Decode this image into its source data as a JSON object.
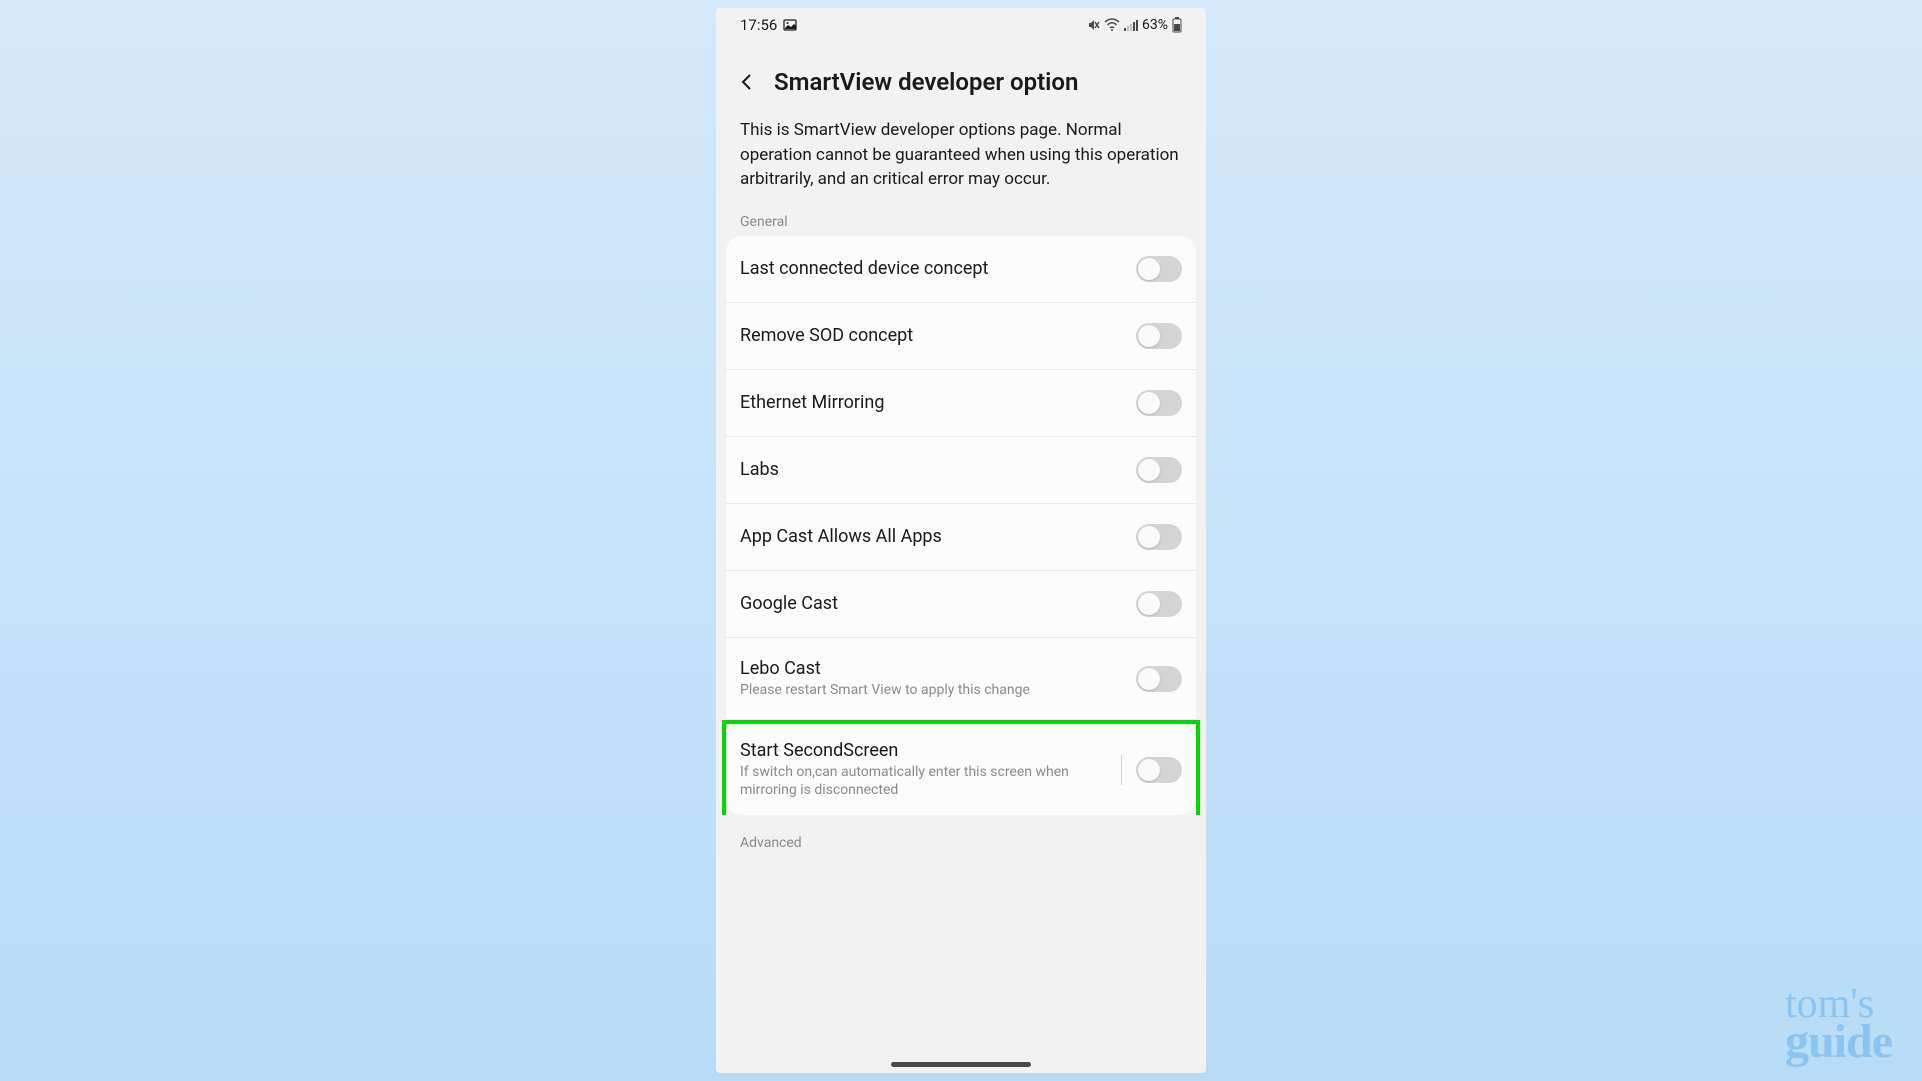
{
  "status_bar": {
    "time": "17:56",
    "battery_percent": "63%"
  },
  "header": {
    "title": "SmartView developer option"
  },
  "description": "This is SmartView developer options page. Normal operation cannot be guaranteed when using this operation arbitrarily, and an critical error may occur.",
  "sections": {
    "general": "General",
    "advanced": "Advanced"
  },
  "settings": {
    "last_connected": {
      "label": "Last connected device concept"
    },
    "remove_sod": {
      "label": "Remove SOD concept"
    },
    "ethernet_mirroring": {
      "label": "Ethernet Mirroring"
    },
    "labs": {
      "label": "Labs"
    },
    "app_cast": {
      "label": "App Cast Allows All Apps"
    },
    "google_cast": {
      "label": "Google Cast"
    },
    "lebo_cast": {
      "label": "Lebo Cast",
      "sublabel": "Please restart Smart View to apply this change"
    },
    "start_second_screen": {
      "label": "Start SecondScreen",
      "sublabel": "If switch on,can automatically enter this screen when mirroring is disconnected"
    }
  },
  "watermark": {
    "top": "tom's",
    "bottom": "guide"
  }
}
